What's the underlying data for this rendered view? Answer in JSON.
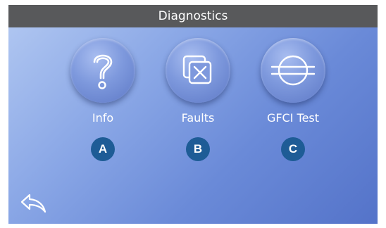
{
  "header": {
    "title": "Diagnostics"
  },
  "tiles": [
    {
      "label": "Info",
      "badge": "A",
      "icon": "question-icon"
    },
    {
      "label": "Faults",
      "badge": "B",
      "icon": "faults-icon"
    },
    {
      "label": "GFCI Test",
      "badge": "C",
      "icon": "gfci-icon"
    }
  ],
  "nav": {
    "back_icon": "back-arrow-icon"
  },
  "colors": {
    "titlebar": "#58595b",
    "badge": "#1e5c96",
    "background_light": "#b3c9f2",
    "background_dark": "#5473c9",
    "text": "#ffffff"
  }
}
